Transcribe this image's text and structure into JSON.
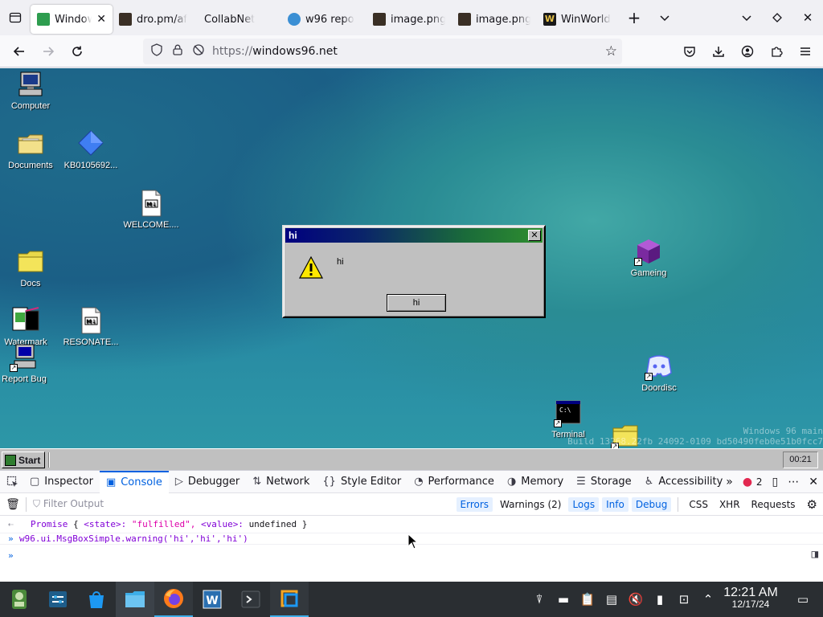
{
  "browser": {
    "tabs": [
      {
        "label": "Window",
        "active": true,
        "favicon_color": "#2e9d4f"
      },
      {
        "label": "dro.pm/af",
        "favicon_color": "#3a2f25"
      },
      {
        "label": "CollabNet"
      },
      {
        "label": "w96 repo",
        "favicon_color": "#3b8fd4"
      },
      {
        "label": "image.png",
        "favicon_color": "#3a2f25"
      },
      {
        "label": "image.png",
        "favicon_color": "#3a2f25"
      },
      {
        "label": "WinWorld",
        "favicon_color": "#1a1a1a"
      }
    ],
    "url_protocol": "https://",
    "url_host": "windows96.net"
  },
  "desktop": {
    "icons": {
      "computer": "Computer",
      "documents": "Documents",
      "kb": "KB0105692...",
      "welcome": "WELCOME....",
      "docs": "Docs",
      "watermark": "Watermark",
      "resonate": "RESONATE...",
      "report_bug": "Report Bug",
      "gameing": "Gameing",
      "doordisc": "Doordisc",
      "terminal": "Terminal"
    },
    "build_line1": "Windows 96 main",
    "build_line2": "Build 13268.22fb 24092-0109 bd50490feb0e51b0fcc7"
  },
  "msgbox": {
    "title": "hi",
    "message": "hi",
    "button": "hi"
  },
  "w96_taskbar": {
    "start": "Start",
    "clock": "00:21"
  },
  "devtools": {
    "tabs": [
      "Inspector",
      "Console",
      "Debugger",
      "Network",
      "Style Editor",
      "Performance",
      "Memory",
      "Storage",
      "Accessibility"
    ],
    "selected_tab": "Console",
    "error_count": "2",
    "filter_placeholder": "Filter Output",
    "levels": [
      "Errors",
      "Warnings (2)",
      "Logs",
      "Info",
      "Debug"
    ],
    "extra_filters": [
      "CSS",
      "XHR",
      "Requests"
    ],
    "console": {
      "promise_prefix": "Promise",
      "promise_state_key": "<state>:",
      "promise_state_val": "\"fulfilled\",",
      "promise_value_key": "<value>:",
      "promise_value_val": "undefined",
      "input_line": "w96.ui.MsgBoxSimple.warning('hi','hi','hi')"
    }
  },
  "kde_panel": {
    "time": "12:21 AM",
    "date": "12/17/24"
  }
}
